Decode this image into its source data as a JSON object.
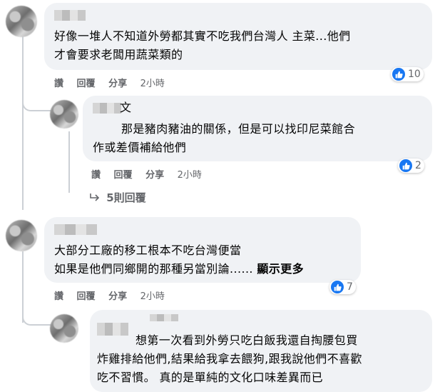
{
  "comments": [
    {
      "lines": [
        "好像一堆人不知道外勞都其實不吃我們台灣人 主菜...他們",
        "才會要求老闆用蔬菜類的"
      ],
      "actions": {
        "like": "讚",
        "reply": "回覆",
        "share": "分享",
        "time": "2小時"
      },
      "reactions": "10"
    },
    {
      "name_fragment": "文",
      "lines": [
        "那是豬肉豬油的關係，但是可以找印尼菜館合",
        "作或差價補給他們"
      ],
      "actions": {
        "like": "讚",
        "reply": "回覆",
        "share": "分享",
        "time": "2小時"
      },
      "reactions": "2",
      "more_replies": "5則回覆"
    },
    {
      "lines": [
        "大部分工廠的移工根本不吃台灣便當",
        "如果是他們同鄉開的那種另當別論......"
      ],
      "see_more": "顯示更多",
      "actions": {
        "like": "讚",
        "reply": "回覆",
        "share": "分享",
        "time": "2小時"
      },
      "reactions": "7"
    },
    {
      "lines": [
        "想第一次看到外勞只吃白飯我還自掏腰包買",
        "炸雞排給他們,結果給我拿去餵狗,跟我說他們不喜歡",
        "吃不習慣。 真的是單純的文化口味差異而已"
      ]
    }
  ],
  "icons": {
    "like": "thumbs-up-icon",
    "reply_arrow": "reply-arrow-icon"
  },
  "colors": {
    "like_blue": "#1877f2",
    "bubble": "#f0f2f5",
    "muted": "#65676b"
  }
}
